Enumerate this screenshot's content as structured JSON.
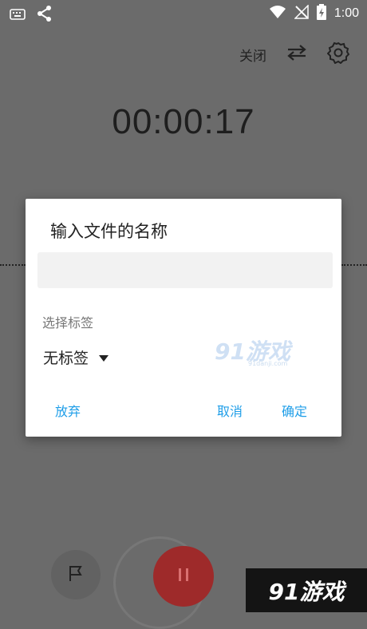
{
  "status_bar": {
    "time": "1:00",
    "icons": [
      "keyboard-icon",
      "share-icon",
      "wifi-icon",
      "no-signal-icon",
      "battery-charging-icon"
    ]
  },
  "toolbar": {
    "close_label": "关闭"
  },
  "timer": {
    "value": "00:00:17"
  },
  "dialog": {
    "title": "输入文件的名称",
    "input_value": "",
    "input_placeholder": "",
    "tag_section_label": "选择标签",
    "tag_selected": "无标签",
    "discard_label": "放弃",
    "cancel_label": "取消",
    "confirm_label": "确定"
  },
  "watermarks": {
    "dialog_logo": "91游戏",
    "dialog_logo_url": "91danji.com",
    "corner_logo": "91游戏"
  },
  "colors": {
    "accent": "#1f9ee8",
    "record_button": "#9e2a2a",
    "scrim": "#6b6b6b"
  }
}
